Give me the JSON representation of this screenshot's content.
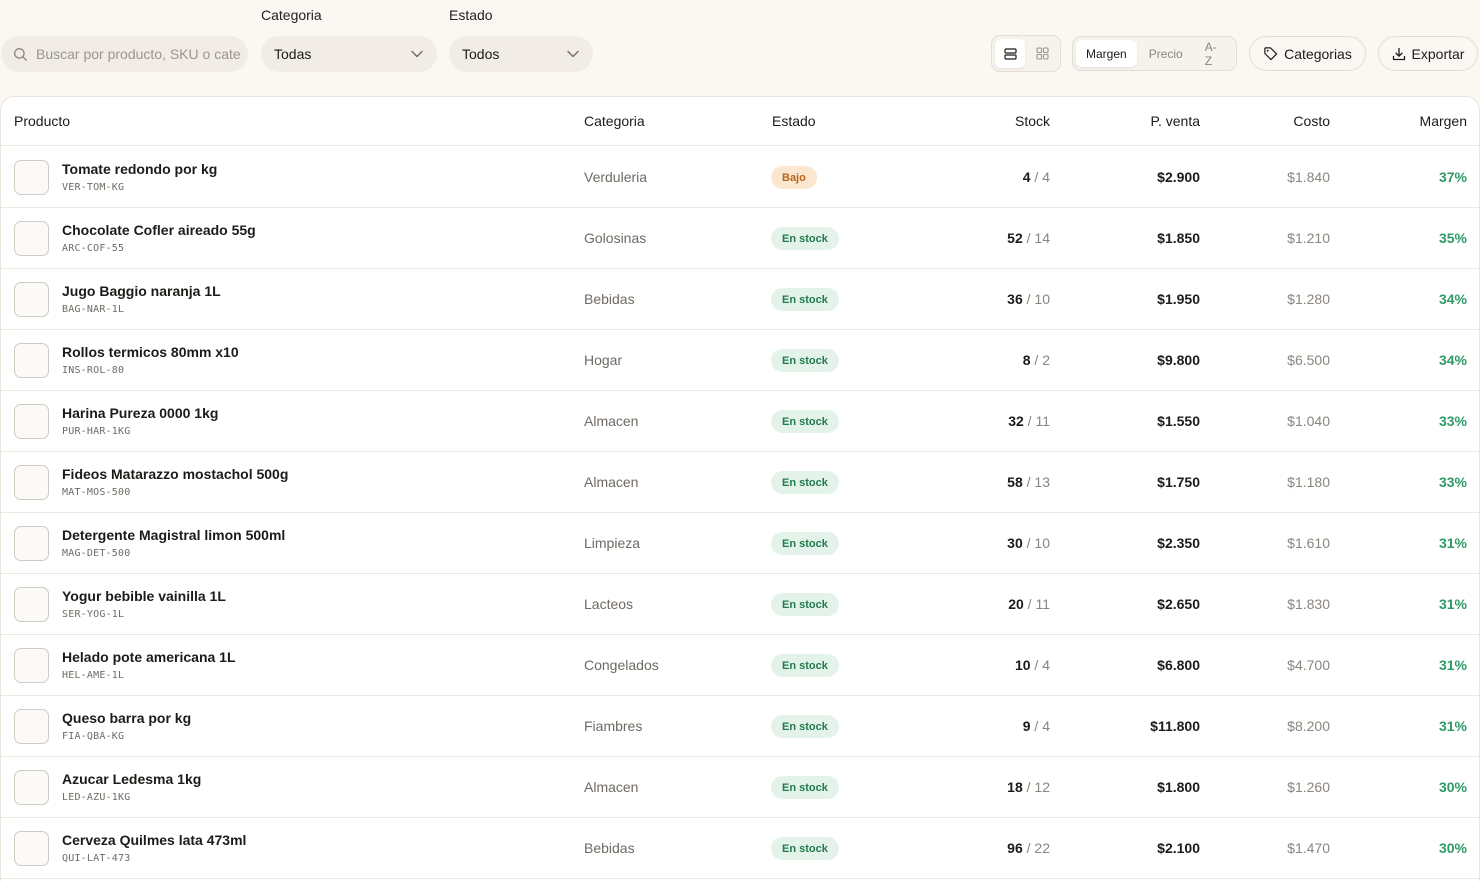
{
  "filters": {
    "search_placeholder": "Buscar por producto, SKU o categoria",
    "category_label": "Categoria",
    "category_value": "Todas",
    "status_label": "Estado",
    "status_value": "Todos"
  },
  "toolbar": {
    "view_modes": [
      {
        "icon": "list-view-icon",
        "active": true
      },
      {
        "icon": "grid-view-icon",
        "active": false
      }
    ],
    "sort_options": [
      {
        "label": "Margen",
        "active": true
      },
      {
        "label": "Precio",
        "active": false
      },
      {
        "label": "A-Z",
        "active": false
      }
    ],
    "categories_label": "Categorias",
    "categories_icon": "tag-icon",
    "export_label": "Exportar",
    "export_icon": "download-icon"
  },
  "colors": {
    "low_badge_bg": "#fbe6cf",
    "low_badge_text": "#b5651d",
    "stock_badge_bg": "#e4f3ea",
    "stock_badge_text": "#237a4f",
    "margin_text": "#2e9a67"
  },
  "table": {
    "columns": {
      "product": "Producto",
      "category": "Categoria",
      "status": "Estado",
      "stock": "Stock",
      "price": "P. venta",
      "cost": "Costo",
      "margin": "Margen"
    },
    "rows": [
      {
        "name": "Tomate redondo por kg",
        "sku": "VER-TOM-KG",
        "category": "Verduleria",
        "status": "Bajo",
        "status_type": "low",
        "stock": "4",
        "stock_min": "4",
        "price": "$2.900",
        "cost": "$1.840",
        "margin": "37%"
      },
      {
        "name": "Chocolate Cofler aireado 55g",
        "sku": "ARC-COF-55",
        "category": "Golosinas",
        "status": "En stock",
        "status_type": "ok",
        "stock": "52",
        "stock_min": "14",
        "price": "$1.850",
        "cost": "$1.210",
        "margin": "35%"
      },
      {
        "name": "Jugo Baggio naranja 1L",
        "sku": "BAG-NAR-1L",
        "category": "Bebidas",
        "status": "En stock",
        "status_type": "ok",
        "stock": "36",
        "stock_min": "10",
        "price": "$1.950",
        "cost": "$1.280",
        "margin": "34%"
      },
      {
        "name": "Rollos termicos 80mm x10",
        "sku": "INS-ROL-80",
        "category": "Hogar",
        "status": "En stock",
        "status_type": "ok",
        "stock": "8",
        "stock_min": "2",
        "price": "$9.800",
        "cost": "$6.500",
        "margin": "34%"
      },
      {
        "name": "Harina Pureza 0000 1kg",
        "sku": "PUR-HAR-1KG",
        "category": "Almacen",
        "status": "En stock",
        "status_type": "ok",
        "stock": "32",
        "stock_min": "11",
        "price": "$1.550",
        "cost": "$1.040",
        "margin": "33%"
      },
      {
        "name": "Fideos Matarazzo mostachol 500g",
        "sku": "MAT-MOS-500",
        "category": "Almacen",
        "status": "En stock",
        "status_type": "ok",
        "stock": "58",
        "stock_min": "13",
        "price": "$1.750",
        "cost": "$1.180",
        "margin": "33%"
      },
      {
        "name": "Detergente Magistral limon 500ml",
        "sku": "MAG-DET-500",
        "category": "Limpieza",
        "status": "En stock",
        "status_type": "ok",
        "stock": "30",
        "stock_min": "10",
        "price": "$2.350",
        "cost": "$1.610",
        "margin": "31%"
      },
      {
        "name": "Yogur bebible vainilla 1L",
        "sku": "SER-YOG-1L",
        "category": "Lacteos",
        "status": "En stock",
        "status_type": "ok",
        "stock": "20",
        "stock_min": "11",
        "price": "$2.650",
        "cost": "$1.830",
        "margin": "31%"
      },
      {
        "name": "Helado pote americana 1L",
        "sku": "HEL-AME-1L",
        "category": "Congelados",
        "status": "En stock",
        "status_type": "ok",
        "stock": "10",
        "stock_min": "4",
        "price": "$6.800",
        "cost": "$4.700",
        "margin": "31%"
      },
      {
        "name": "Queso barra por kg",
        "sku": "FIA-QBA-KG",
        "category": "Fiambres",
        "status": "En stock",
        "status_type": "ok",
        "stock": "9",
        "stock_min": "4",
        "price": "$11.800",
        "cost": "$8.200",
        "margin": "31%"
      },
      {
        "name": "Azucar Ledesma 1kg",
        "sku": "LED-AZU-1KG",
        "category": "Almacen",
        "status": "En stock",
        "status_type": "ok",
        "stock": "18",
        "stock_min": "12",
        "price": "$1.800",
        "cost": "$1.260",
        "margin": "30%"
      },
      {
        "name": "Cerveza Quilmes lata 473ml",
        "sku": "QUI-LAT-473",
        "category": "Bebidas",
        "status": "En stock",
        "status_type": "ok",
        "stock": "96",
        "stock_min": "22",
        "price": "$2.100",
        "cost": "$1.470",
        "margin": "30%"
      }
    ]
  }
}
